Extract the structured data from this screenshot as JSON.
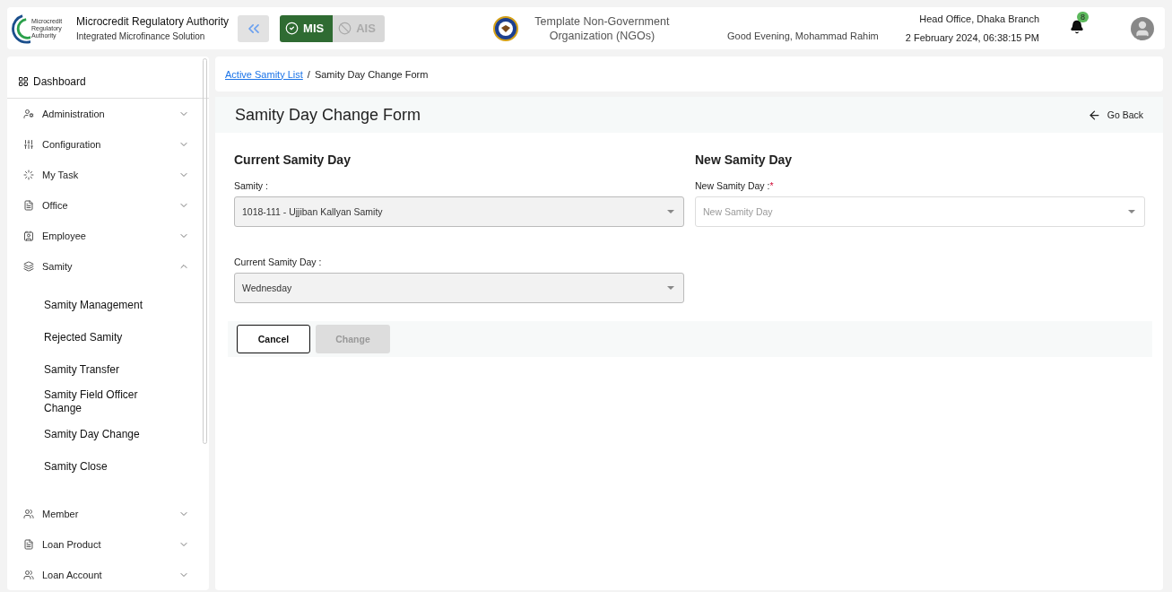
{
  "header": {
    "logo_text": "Microcredit Regulatory Authority",
    "title": "Microcredit Regulatory Authority",
    "subtitle": "Integrated Microfinance Solution",
    "modules": [
      {
        "label": "MIS",
        "selected": true
      },
      {
        "label": "AIS",
        "selected": false
      }
    ],
    "organization": "Template Non-Government Organization (NGOs)",
    "greeting": "Good Evening, Mohammad Rahim",
    "branch": "Head Office, Dhaka Branch",
    "datetime": "2 February 2024, 06:38:15 PM",
    "notification_count": "8"
  },
  "sidebar": {
    "dashboard": "Dashboard",
    "items": [
      {
        "label": "Administration",
        "expanded": false
      },
      {
        "label": "Configuration",
        "expanded": false
      },
      {
        "label": "My Task",
        "expanded": false
      },
      {
        "label": "Office",
        "expanded": false
      },
      {
        "label": "Employee",
        "expanded": false
      },
      {
        "label": "Samity",
        "expanded": true,
        "children": [
          {
            "label": "Samity Management"
          },
          {
            "label": "Rejected Samity"
          },
          {
            "label": "Samity Transfer"
          },
          {
            "label": "Samity Field Officer Change"
          },
          {
            "label": "Samity Day Change"
          },
          {
            "label": "Samity Close"
          }
        ]
      },
      {
        "label": "Member",
        "expanded": false
      },
      {
        "label": "Loan Product",
        "expanded": false
      },
      {
        "label": "Loan Account",
        "expanded": false
      }
    ]
  },
  "breadcrumb": {
    "link": "Active Samity List",
    "separator": "/",
    "current": "Samity Day Change Form"
  },
  "form": {
    "title": "Samity Day Change Form",
    "back": "Go Back",
    "sections": [
      {
        "heading": "Current Samity Day",
        "fields": [
          {
            "label": "Samity :",
            "value": "1018-111 - Ujjiban Kallyan Samity",
            "disabled": true
          },
          {
            "label": "Current Samity Day :",
            "value": "Wednesday",
            "disabled": true
          }
        ]
      },
      {
        "heading": "New Samity Day",
        "fields": [
          {
            "label": "New Samity Day :",
            "required_mark": "*",
            "placeholder": "New Samity Day",
            "disabled": false
          }
        ]
      }
    ],
    "buttons": [
      {
        "label": "Cancel",
        "disabled": false
      },
      {
        "label": "Change",
        "disabled": true
      }
    ]
  }
}
